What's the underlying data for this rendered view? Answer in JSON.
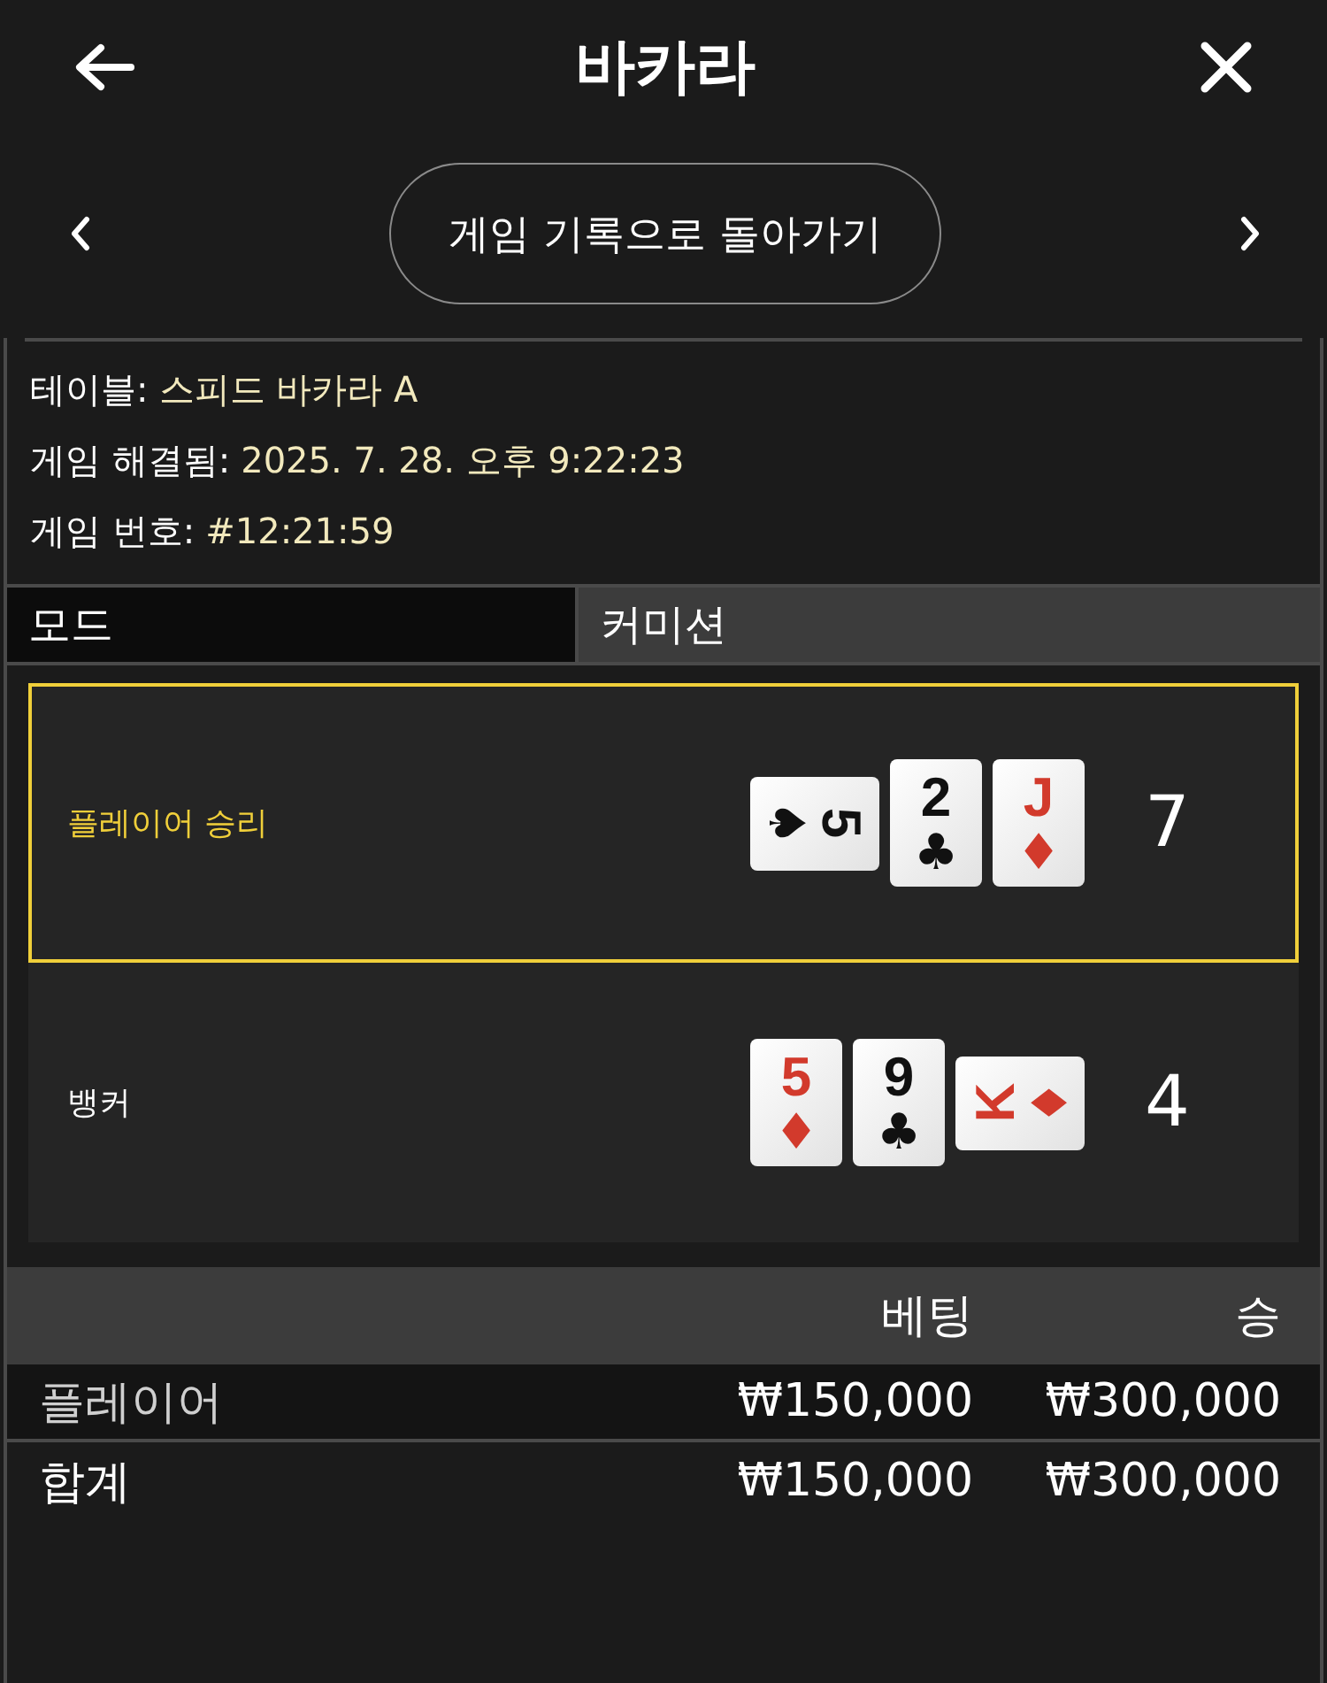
{
  "header": {
    "title": "바카라"
  },
  "nav": {
    "button": "게임 기록으로 돌아가기"
  },
  "info": [
    {
      "label": "테이블:",
      "value": "스피드 바카라 A"
    },
    {
      "label": "게임 해결됨:",
      "value": "2025. 7. 28. 오후 9:22:23"
    },
    {
      "label": "게임 번호:",
      "value": "#12:21:59"
    }
  ],
  "mode": {
    "label": "모드",
    "value": "커미션"
  },
  "hands": [
    {
      "label": "플레이어 승리",
      "winner": true,
      "score": "7",
      "cards": [
        {
          "rank": "5",
          "suit": "♠",
          "color": "#111111",
          "kind": "cw"
        },
        {
          "rank": "2",
          "suit": "♣",
          "color": "#111111",
          "kind": "upright"
        },
        {
          "rank": "J",
          "suit": "♦",
          "color": "#d23a2c",
          "kind": "upright"
        }
      ]
    },
    {
      "label": "뱅커",
      "winner": false,
      "score": "4",
      "cards": [
        {
          "rank": "5",
          "suit": "♦",
          "color": "#d23a2c",
          "kind": "upright"
        },
        {
          "rank": "9",
          "suit": "♣",
          "color": "#111111",
          "kind": "upright"
        },
        {
          "rank": "K",
          "suit": "♦",
          "color": "#d23a2c",
          "kind": "ccw"
        }
      ]
    }
  ],
  "bets": {
    "columns": [
      "베팅",
      "승"
    ],
    "rows": [
      {
        "kind": "bet",
        "label": "플레이어",
        "bet": "₩150,000",
        "win": "₩300,000"
      },
      {
        "kind": "total",
        "label": "합계",
        "bet": "₩150,000",
        "win": "₩300,000"
      }
    ]
  }
}
